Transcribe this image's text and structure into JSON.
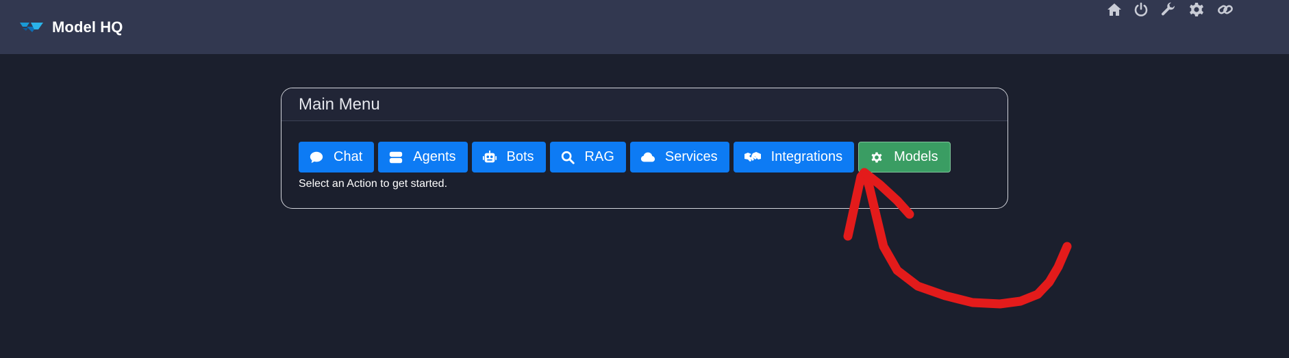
{
  "header": {
    "app_title": "Model HQ",
    "logo_icon": "model-hq-logo",
    "nav_icons": [
      "home-icon",
      "power-icon",
      "wrench-icon",
      "gear-icon",
      "link-icon"
    ]
  },
  "main_menu": {
    "title": "Main Menu",
    "buttons": [
      {
        "label": "Chat",
        "icon": "chat-bubble-icon",
        "color": "#0d7bf4"
      },
      {
        "label": "Agents",
        "icon": "server-icon",
        "color": "#0d7bf4"
      },
      {
        "label": "Bots",
        "icon": "robot-icon",
        "color": "#0d7bf4"
      },
      {
        "label": "RAG",
        "icon": "search-icon",
        "color": "#0d7bf4"
      },
      {
        "label": "Services",
        "icon": "cloud-icon",
        "color": "#0d7bf4"
      },
      {
        "label": "Integrations",
        "icon": "handshake-icon",
        "color": "#0d7bf4"
      },
      {
        "label": "Models",
        "icon": "gear-icon",
        "color": "#3a9d63"
      }
    ],
    "hint": "Select an Action to get started."
  },
  "colors": {
    "background": "#1b1f2d",
    "topbar": "#323850",
    "primary_button": "#0d7bf4",
    "success_button": "#3a9d63",
    "annotation_arrow": "#e31b1b"
  }
}
